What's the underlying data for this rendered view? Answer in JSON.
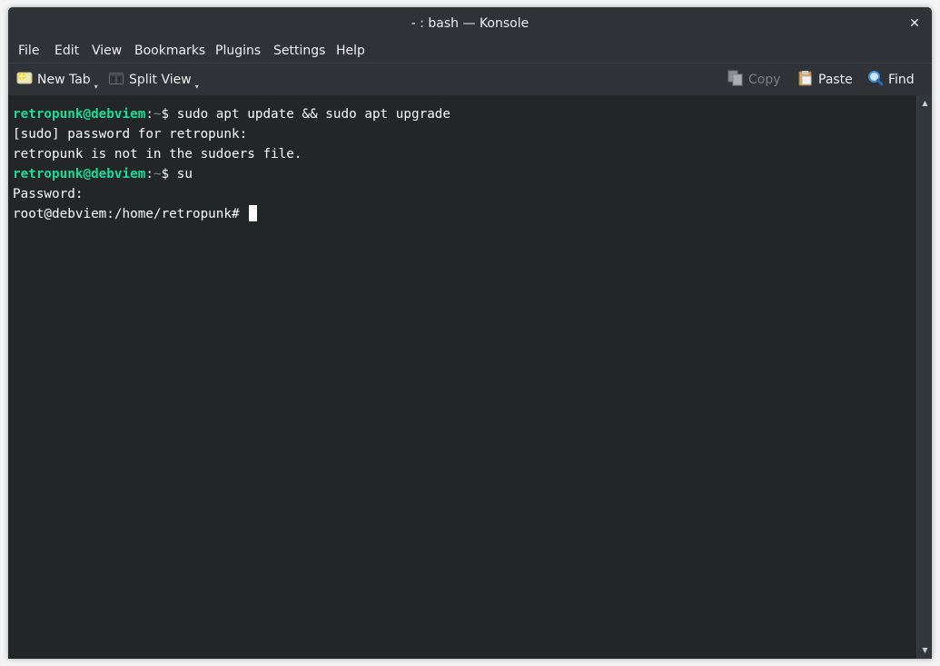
{
  "window": {
    "title": "- : bash — Konsole"
  },
  "menubar": {
    "items": [
      "File",
      "Edit",
      "View",
      "Bookmarks",
      "Plugins",
      "Settings",
      "Help"
    ]
  },
  "toolbar": {
    "new_tab": "New Tab",
    "split_view": "Split View",
    "copy": "Copy",
    "paste": "Paste",
    "find": "Find"
  },
  "terminal": {
    "prompt_user": "retropunk@debviem",
    "prompt_sep": ":",
    "prompt_dir": "~",
    "prompt_symbol": "$",
    "lines": [
      {
        "cmd": " sudo apt update && sudo apt upgrade"
      },
      {
        "text": "[sudo] password for retropunk:"
      },
      {
        "text": "retropunk is not in the sudoers file."
      },
      {
        "cmd": " su"
      },
      {
        "text": "Password:"
      },
      {
        "text": "root@debviem:/home/retropunk# "
      }
    ]
  },
  "colors": {
    "terminal_bg": "#232627",
    "prompt_user": "#1cdc9a",
    "window_bg": "#2f3337"
  }
}
